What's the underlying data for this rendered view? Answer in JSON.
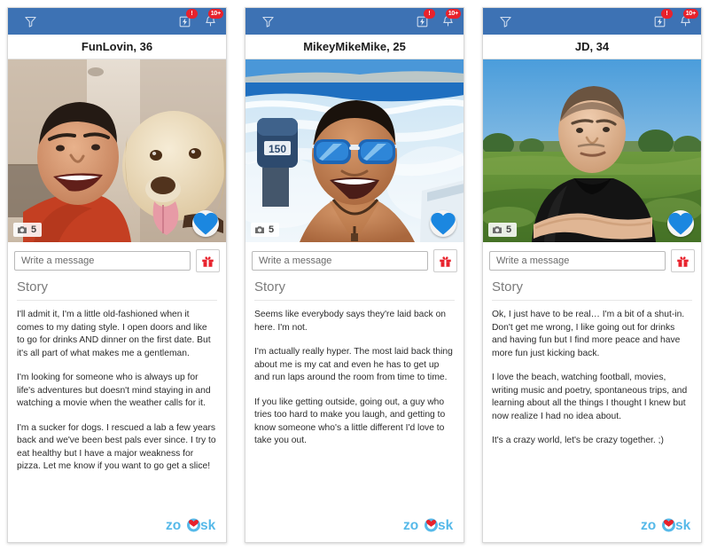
{
  "app": {
    "name": "Zoosk",
    "brand_color": "#3d72b4",
    "accent_red": "#e8222c",
    "heart_blue": "#1b87e0",
    "logo_text": "zoosk"
  },
  "appbar": {
    "filter_icon": "funnel-icon",
    "boost_icon": "lightning-bolt-icon",
    "boost_badge": "!",
    "notifications_icon": "bell-icon",
    "notifications_badge": "10+"
  },
  "common": {
    "message_placeholder": "Write a message",
    "gift_icon": "gift-icon",
    "camera_icon": "camera-icon",
    "heart_icon": "heart-icon",
    "story_heading": "Story"
  },
  "cards": [
    {
      "name": "FunLovin, 36",
      "photo_count": "5",
      "photo_alt": "smiling-man-with-yellow-labrador-selfie",
      "story": [
        "I'll admit it, I'm a little old-fashioned when it comes to my dating style. I open doors and like to go for drinks AND dinner on the first date. But it's all part of what makes me a gentleman.",
        "I'm looking for someone who is always up for life's adventures but doesn't mind staying in and watching a movie when the weather calls for it.",
        "I'm a sucker for dogs. I rescued a lab a few years back and we've been best pals ever since. I try to eat healthy but I have a major weakness for pizza. Let me know if you want to go get a slice!"
      ]
    },
    {
      "name": "MikeyMikeMike, 25",
      "photo_count": "5",
      "photo_alt": "shirtless-man-in-blue-mirrored-sunglasses-on-boat",
      "story": [
        "Seems like everybody says they're laid back on here. I'm not.",
        "I'm actually really hyper. The most laid back thing about me is my cat and even he has to get up and run laps around the room from time to time.",
        "If you like getting outside, going out, a guy who tries too hard to make you laugh, and getting to know someone who's a little different I'd love to take you out."
      ]
    },
    {
      "name": "JD, 34",
      "photo_count": "5",
      "photo_alt": "man-in-black-tshirt-arms-crossed-in-field",
      "story": [
        "Ok, I just have to be real… I'm a bit of a shut-in. Don't get me wrong, I like going out for drinks and having fun but I find more peace and have more fun just kicking back.",
        "I love the beach, watching football, movies, writing music and poetry, spontaneous trips, and learning about all the things I thought I knew but now realize I had no idea about.",
        "It's a crazy world, let's be crazy together. ;)"
      ]
    }
  ]
}
